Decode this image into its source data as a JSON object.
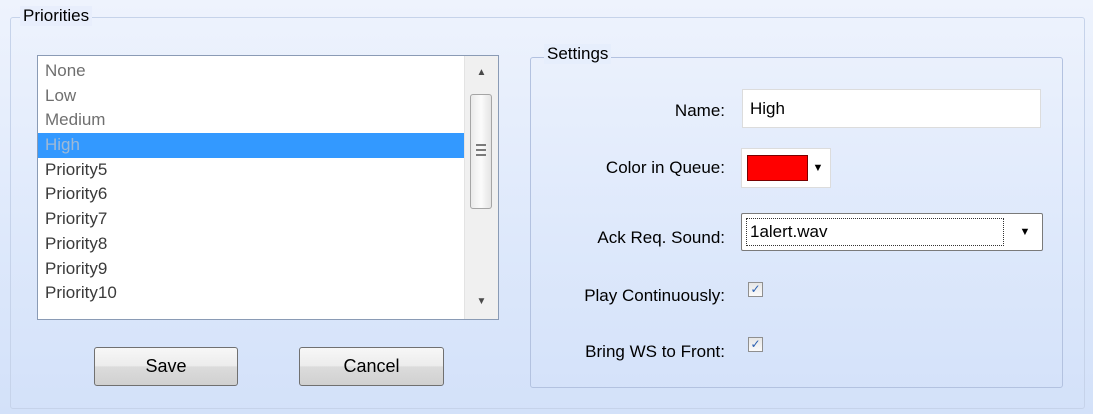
{
  "priorities_group": {
    "title": "Priorities"
  },
  "priority_list": {
    "items": [
      {
        "label": "None",
        "muted": true
      },
      {
        "label": "Low",
        "muted": true
      },
      {
        "label": "Medium",
        "muted": true
      },
      {
        "label": "High",
        "selected": true
      },
      {
        "label": "Priority5"
      },
      {
        "label": "Priority6"
      },
      {
        "label": "Priority7"
      },
      {
        "label": "Priority8"
      },
      {
        "label": "Priority9"
      },
      {
        "label": "Priority10"
      }
    ]
  },
  "buttons": {
    "save": "Save",
    "cancel": "Cancel"
  },
  "settings": {
    "title": "Settings",
    "name_label": "Name:",
    "name_value": "High",
    "color_label": "Color in Queue:",
    "color_value": "#ff0000",
    "sound_label": "Ack Req. Sound:",
    "sound_value": "1alert.wav",
    "play_label": "Play Continuously:",
    "play_checked": true,
    "bring_label": "Bring WS to Front:",
    "bring_checked": true
  },
  "icons": {
    "scroll_up": "▲",
    "scroll_down": "▼",
    "dropdown": "▼",
    "check": "✓"
  }
}
